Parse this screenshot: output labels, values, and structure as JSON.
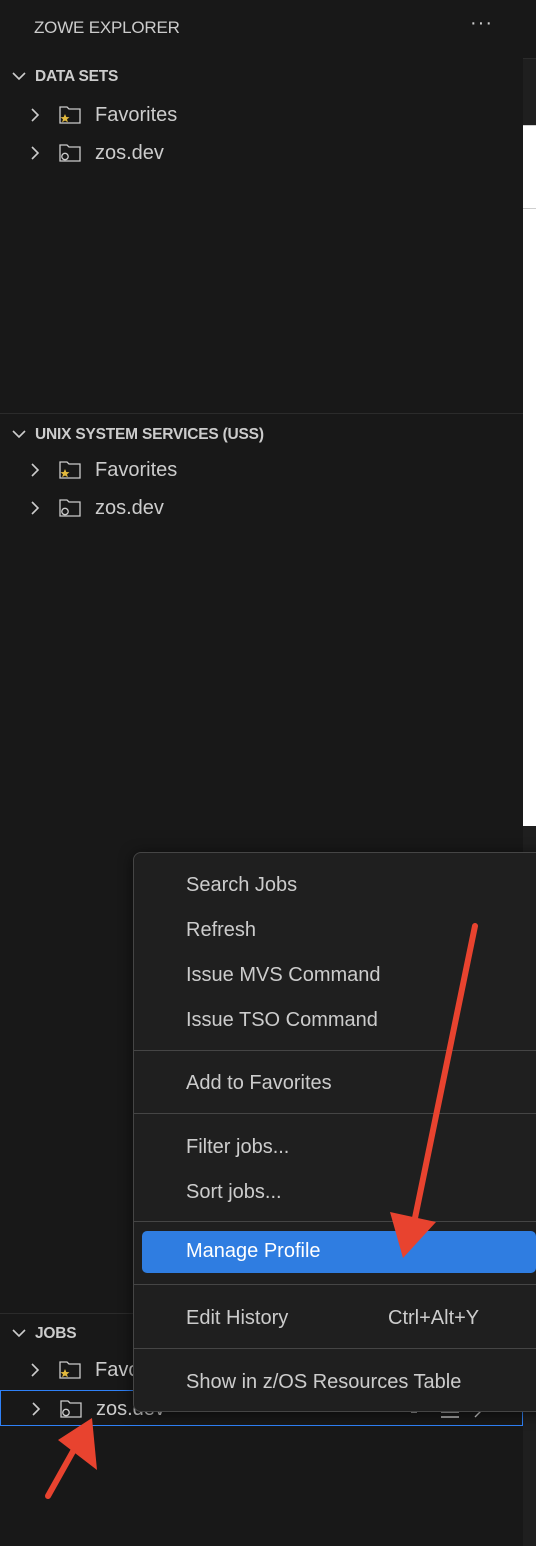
{
  "panel": {
    "title": "ZOWE EXPLORER",
    "more_label": "···"
  },
  "sections": {
    "datasets": {
      "label": "DATA SETS",
      "items": [
        {
          "label": "Favorites"
        },
        {
          "label": "zos.dev"
        }
      ]
    },
    "uss": {
      "label": "UNIX SYSTEM SERVICES (USS)",
      "items": [
        {
          "label": "Favorites"
        },
        {
          "label": "zos.dev"
        }
      ]
    },
    "jobs": {
      "label": "JOBS",
      "items": [
        {
          "label": "Favorites"
        },
        {
          "label": "zos.dev"
        }
      ]
    }
  },
  "context_menu": {
    "items": [
      {
        "label": "Search Jobs"
      },
      {
        "label": "Refresh"
      },
      {
        "label": "Issue MVS Command"
      },
      {
        "label": "Issue TSO Command"
      },
      {
        "label": "Add to Favorites"
      },
      {
        "label": "Filter jobs..."
      },
      {
        "label": "Sort jobs..."
      },
      {
        "label": "Manage Profile"
      },
      {
        "label": "Edit History",
        "shortcut": "Ctrl+Alt+Y"
      },
      {
        "label": "Show in z/OS Resources Table"
      }
    ]
  },
  "colors": {
    "background": "#181818",
    "menu_background": "#1f1f1f",
    "highlight": "#2f7de1",
    "selection_border": "#2f81f7",
    "annotation_arrow": "#e8432f",
    "favorite_star": "#e2b93d"
  },
  "icons": {
    "collapse": "chevron-down-icon",
    "expand": "chevron-right-icon",
    "favorites": "favorites-folder-icon",
    "profile": "profile-folder-icon",
    "more": "ellipsis-icon"
  }
}
